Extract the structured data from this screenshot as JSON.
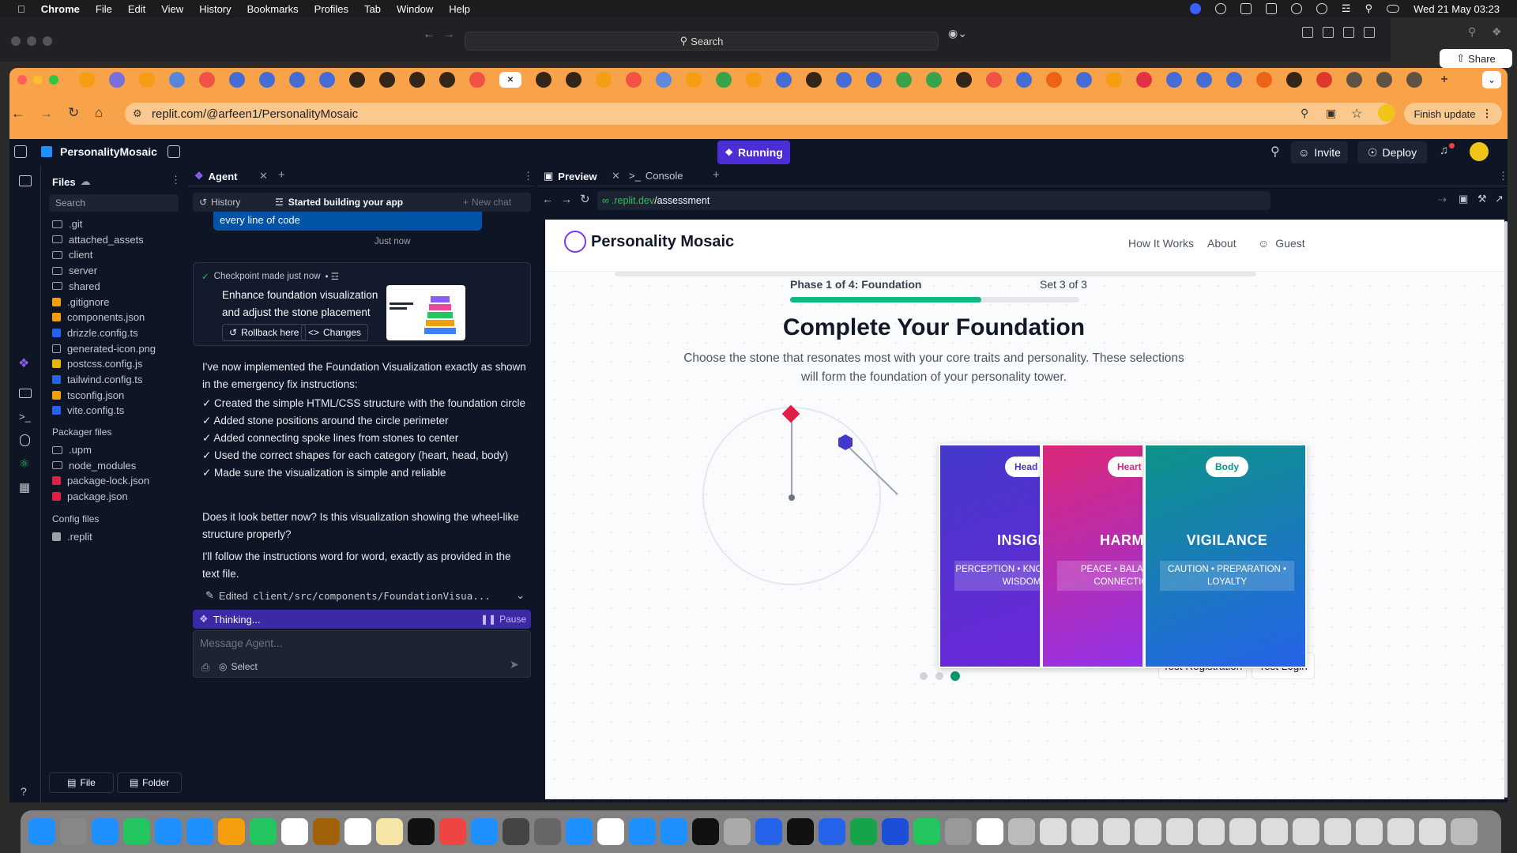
{
  "menubar": {
    "app": "Chrome",
    "items": [
      "File",
      "Edit",
      "View",
      "History",
      "Bookmarks",
      "Profiles",
      "Tab",
      "Window",
      "Help"
    ],
    "clock": "Wed 21 May  03:23"
  },
  "backwindow": {
    "search": "Search",
    "share": "Share"
  },
  "browser": {
    "url": "replit.com/@arfeen1/PersonalityMosaic",
    "finish_update": "Finish update"
  },
  "replit": {
    "project": "PersonalityMosaic",
    "status": "Running",
    "invite": "Invite",
    "deploy": "Deploy",
    "files_title": "Files",
    "search_placeholder": "Search",
    "files": [
      ".git",
      "attached_assets",
      "client",
      "server",
      "shared",
      ".gitignore",
      "components.json",
      "drizzle.config.ts",
      "generated-icon.png",
      "postcss.config.js",
      "tailwind.config.ts",
      "tsconfig.json",
      "vite.config.ts"
    ],
    "packager_title": "Packager files",
    "packager_files": [
      ".upm",
      "node_modules",
      "package-lock.json",
      "package.json"
    ],
    "config_title": "Config files",
    "config_files": [
      ".replit"
    ],
    "file_btn": "File",
    "folder_btn": "Folder",
    "help": "?"
  },
  "agent": {
    "tab": "Agent",
    "history": "History",
    "started": "Started building your app",
    "new_chat": "New chat",
    "prev_bubble": "every line of code",
    "just_now": "Just now",
    "checkpoint": "Checkpoint made just now",
    "checkpoint_desc": "Enhance foundation visualization and adjust the stone placement",
    "rollback": "Rollback here",
    "changes": "Changes",
    "p1": "I've now implemented the Foundation Visualization exactly as shown in the emergency fix instructions:",
    "bullets": [
      "✓ Created the simple HTML/CSS structure with the foundation circle",
      "✓ Added stone positions around the circle perimeter",
      "✓ Added connecting spoke lines from stones to center",
      "✓ Used the correct shapes for each category (heart, head, body)",
      "✓ Made sure the visualization is simple and reliable"
    ],
    "p2": "Does it look better now? Is this visualization showing the wheel-like structure properly?",
    "p3": "I'll follow the instructions word for word, exactly as provided in the text file.",
    "edited_prefix": "Edited ",
    "edited_path": "client/src/components/FoundationVisua...",
    "thinking": "Thinking...",
    "pause": "Pause",
    "input_placeholder": "Message Agent...",
    "select": "Select"
  },
  "preview": {
    "tab_preview": "Preview",
    "tab_console": "Console",
    "url_prefix": ".replit.dev",
    "url_path": "/assessment"
  },
  "site": {
    "brand": "Personality Mosaic",
    "nav": [
      "How It Works",
      "About",
      "Guest"
    ],
    "phase": "Phase 1 of 4: Foundation",
    "set": "Set 3 of 3",
    "progress": 0.66,
    "title": "Complete Your Foundation",
    "subtitle_line1": "Choose the stone that resonates most with your core traits and personality. These selections",
    "subtitle_line2": "will form the foundation of your personality tower.",
    "cards": [
      {
        "badge": "Head",
        "title": "INSIGHT",
        "sub": "PERCEPTION • KNOWLEDGE • WISDOM",
        "badge_color": "#4338ca"
      },
      {
        "badge": "Heart",
        "title": "HARMONY",
        "sub": "PEACE • BALANCE • CONNECTION",
        "badge_color": "#db2777"
      },
      {
        "badge": "Body",
        "title": "VIGILANCE",
        "sub": "CAUTION • PREPARATION • LOYALTY",
        "badge_color": "#0d9488"
      }
    ],
    "test_registration": "Test Registration",
    "test_login": "Test Login",
    "dots_active": 2
  }
}
